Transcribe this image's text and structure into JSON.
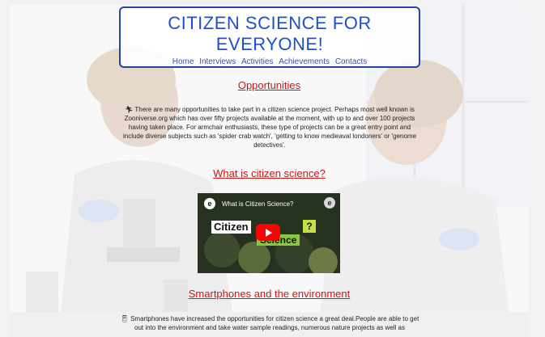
{
  "header": {
    "title_line1": "CITIZEN SCIENCE FOR",
    "title_line2": "EVERYONE!",
    "nav": [
      "Home",
      "Interviews",
      "Activities",
      "Achievements",
      "Contacts"
    ]
  },
  "sections": {
    "opportunities": {
      "title": "Opportunities",
      "icon": "running-person-icon",
      "text": "There are many opportunities to take part in a citizen science project. Perhaps most well known is Zooniverse.org which has over fifty projects available at the moment, with up to and over 100 projects having taken place. For armchair enthusiasts, these type of projects can be a great entry point and include diverse subjects such as 'spider crab watch', 'getting to know medieaval londoners' or 'genome detectives'."
    },
    "what_is": {
      "title": "What is citizen science?",
      "video": {
        "title": "What is Citizen Science?",
        "word1": "Citizen",
        "word2": "Science",
        "badge": "?",
        "logo": "e"
      }
    },
    "smartphones": {
      "title": "Smartphones and the environment",
      "icon": "smartphone-icon",
      "text": "Smartphones have increased the opportunities for citizen science a great deal.People are able to get out into the environment and take water sample readings, numerous nature projects as well as"
    }
  },
  "colors": {
    "title_blue": "#1d4fd1",
    "header_border": "#2345a7",
    "section_red": "#d11414",
    "youtube_red": "#ff0000"
  }
}
